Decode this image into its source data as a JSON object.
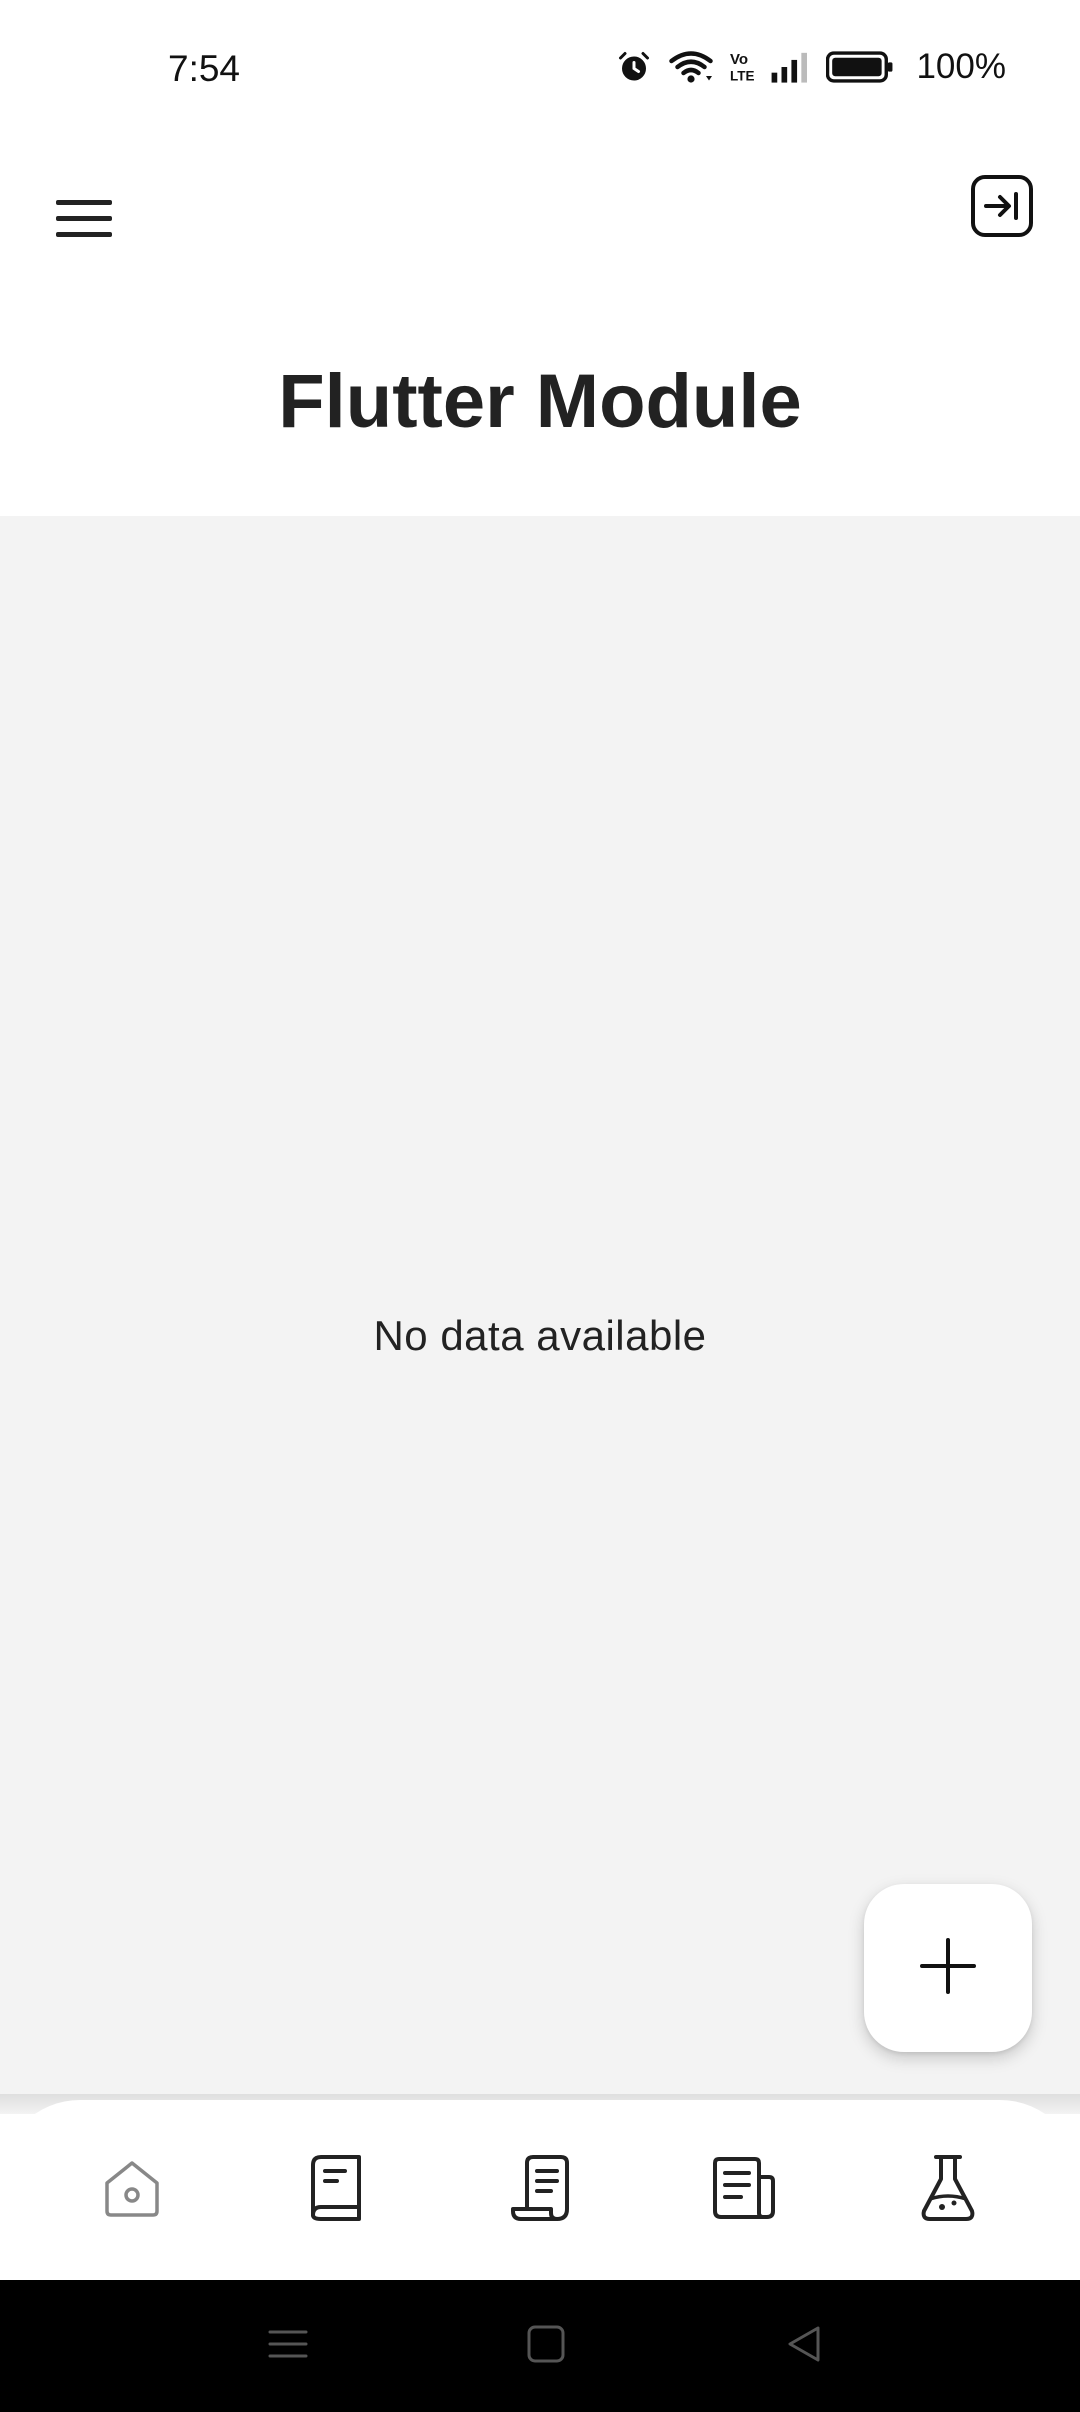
{
  "status_bar": {
    "time": "7:54",
    "battery": "100%",
    "icons": [
      "alarm-icon",
      "wifi-icon",
      "volte-icon",
      "signal-icon",
      "battery-icon"
    ]
  },
  "app_bar": {
    "title": "Flutter Module",
    "menu_icon": "hamburger-menu-icon",
    "exit_icon": "logout-icon"
  },
  "content": {
    "empty_message": "No data available"
  },
  "fab": {
    "icon": "plus-icon"
  },
  "bottom_nav": {
    "items": [
      {
        "icon": "home-icon",
        "active": true
      },
      {
        "icon": "book-icon",
        "active": false
      },
      {
        "icon": "scroll-icon",
        "active": false
      },
      {
        "icon": "newspaper-icon",
        "active": false
      },
      {
        "icon": "flask-icon",
        "active": false
      }
    ]
  },
  "system_nav": {
    "buttons": [
      "recents-icon",
      "home-square-icon",
      "back-triangle-icon"
    ]
  },
  "colors": {
    "background": "#ffffff",
    "content_bg": "#f3f3f3",
    "text": "#222222",
    "icon": "#222222",
    "icon_muted": "#888888",
    "system_nav_bg": "#000000"
  }
}
